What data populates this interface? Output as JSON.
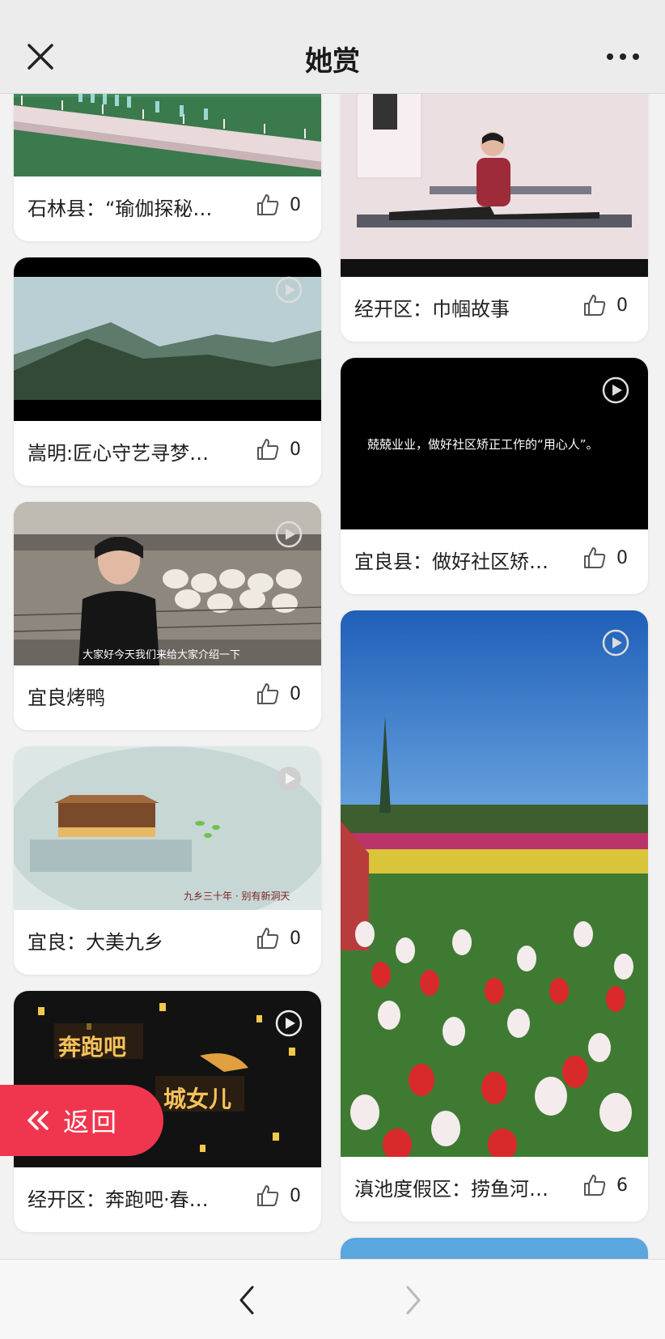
{
  "header": {
    "title": "她赏",
    "close_icon": "close-icon",
    "more_icon": "more-icon"
  },
  "left_column": [
    {
      "title": "石林县：“瑜伽探秘…",
      "likes": "0"
    },
    {
      "title": "嵩明:匠心守艺寻梦…",
      "likes": "0"
    },
    {
      "title": "宜良烤鸭",
      "likes": "0",
      "caption": "大家好今天我们来给大家介绍一下"
    },
    {
      "title": "宜良：大美九乡",
      "likes": "0",
      "caption": "九乡三十年 · 别有新洞天"
    },
    {
      "title": "经开区：奔跑吧·春…",
      "likes": "0",
      "caption_top": "奔跑吧",
      "caption_bottom": "城女儿"
    }
  ],
  "right_column": [
    {
      "title": "经开区：巾帼故事",
      "likes": "0"
    },
    {
      "title": "宜良县：做好社区矫…",
      "likes": "0",
      "caption": "兢兢业业，做好社区矫正工作的“用心人”。"
    },
    {
      "title": "滇池度假区：捞鱼河…",
      "likes": "6"
    }
  ],
  "back_button": {
    "label": "返回"
  },
  "colors": {
    "accent": "#f0364e",
    "background": "#f2f2f2"
  }
}
